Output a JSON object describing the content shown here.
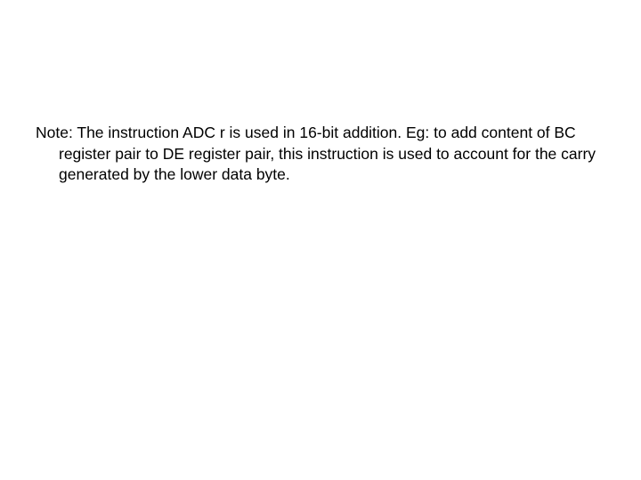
{
  "note": {
    "text": "Note: The instruction ADC r is used in 16-bit addition. Eg: to add content of BC register pair to DE register pair, this instruction is used to account for the carry generated by the lower data byte."
  }
}
